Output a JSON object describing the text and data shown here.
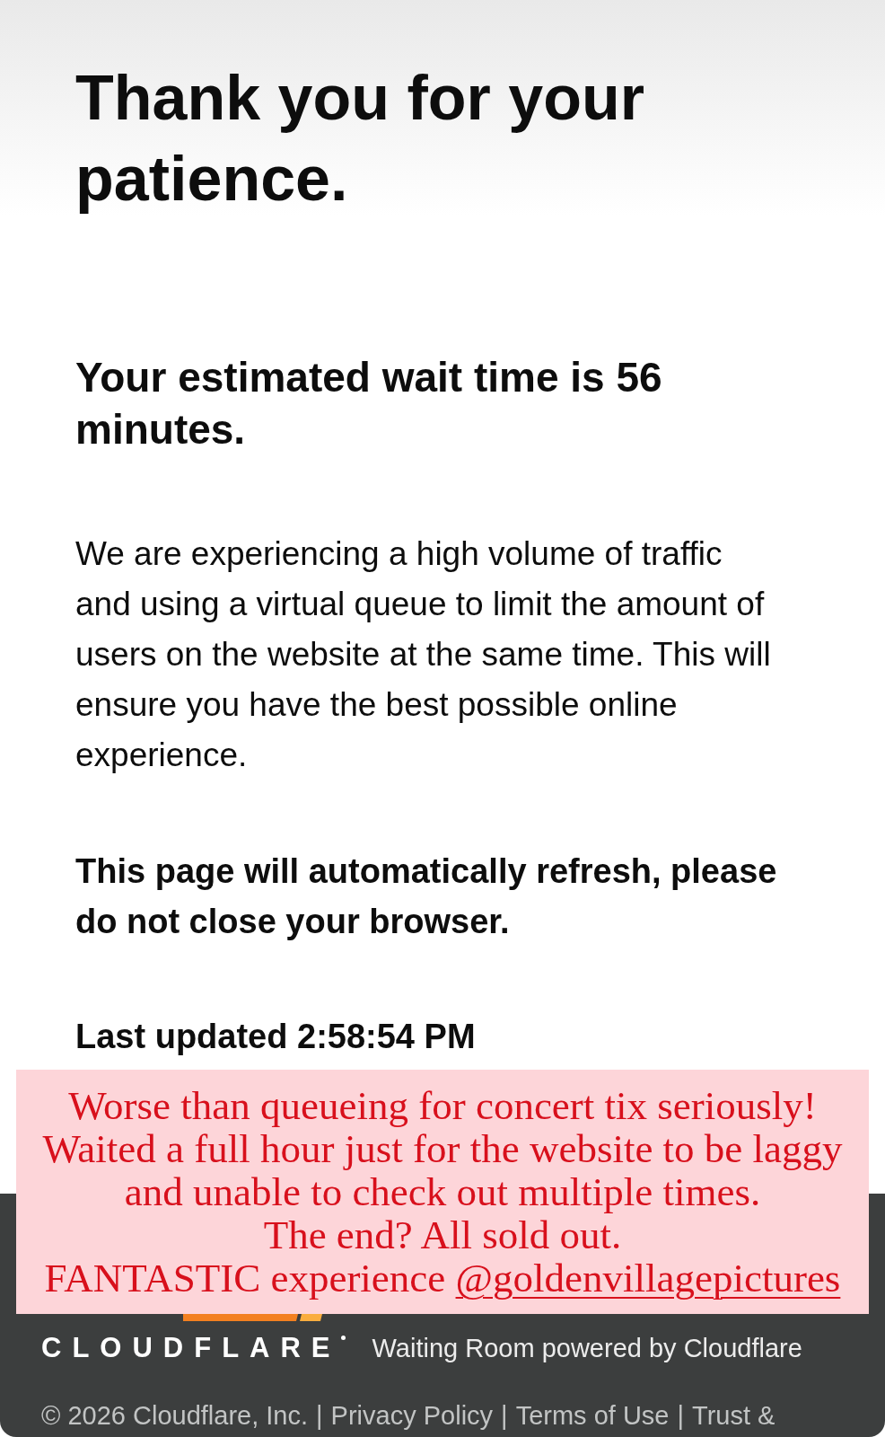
{
  "page": {
    "title": "Thank you for your patience.",
    "wait_time": "Your estimated wait time is 56 minutes.",
    "message": "We are experiencing a high volume of traffic and using a virtual queue to limit the amount of users on the website at the same time. This will ensure you have the best possible online experience.",
    "refresh_notice": "This page will automatically refresh, please do not close your browser.",
    "last_updated": "Last updated 2:58:54 PM"
  },
  "caption": {
    "text": "Worse than queueing for concert tix seriously!\nWaited a full hour just for the website to be laggy\nand unable to check out multiple times.\nThe end? All sold out.\nFANTASTIC experience",
    "mention": "@goldenvillagepictures"
  },
  "footer": {
    "brand": "CLOUDFLARE",
    "tagline": "Waiting Room powered by Cloudflare",
    "copyright": "© 2026 Cloudflare, Inc.",
    "links": [
      {
        "separator": "|",
        "text": "Privacy Policy"
      },
      {
        "separator": "|",
        "text": "Terms of Use"
      },
      {
        "separator": "|",
        "text": "Trust &"
      }
    ]
  }
}
